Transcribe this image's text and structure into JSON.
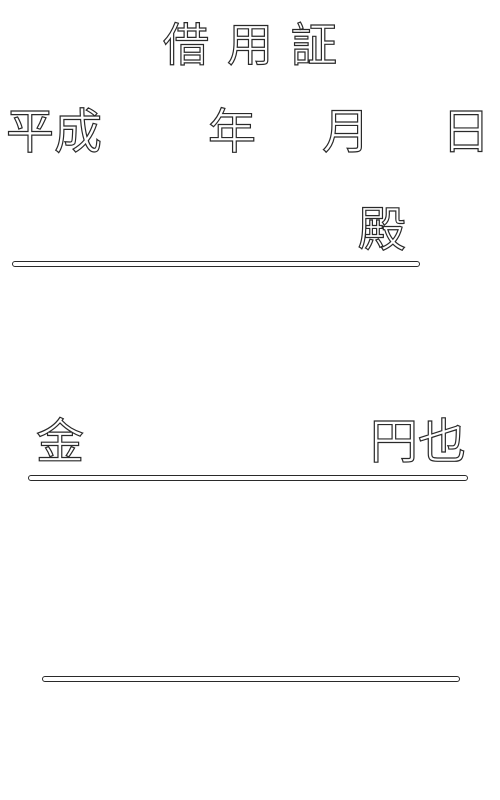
{
  "document": {
    "title": "借用証",
    "date": {
      "era": "平成",
      "year_label": "年",
      "month_label": "月",
      "day_label": "日"
    },
    "addressee_suffix": "殿",
    "amount": {
      "prefix": "金",
      "suffix": "円也"
    }
  }
}
